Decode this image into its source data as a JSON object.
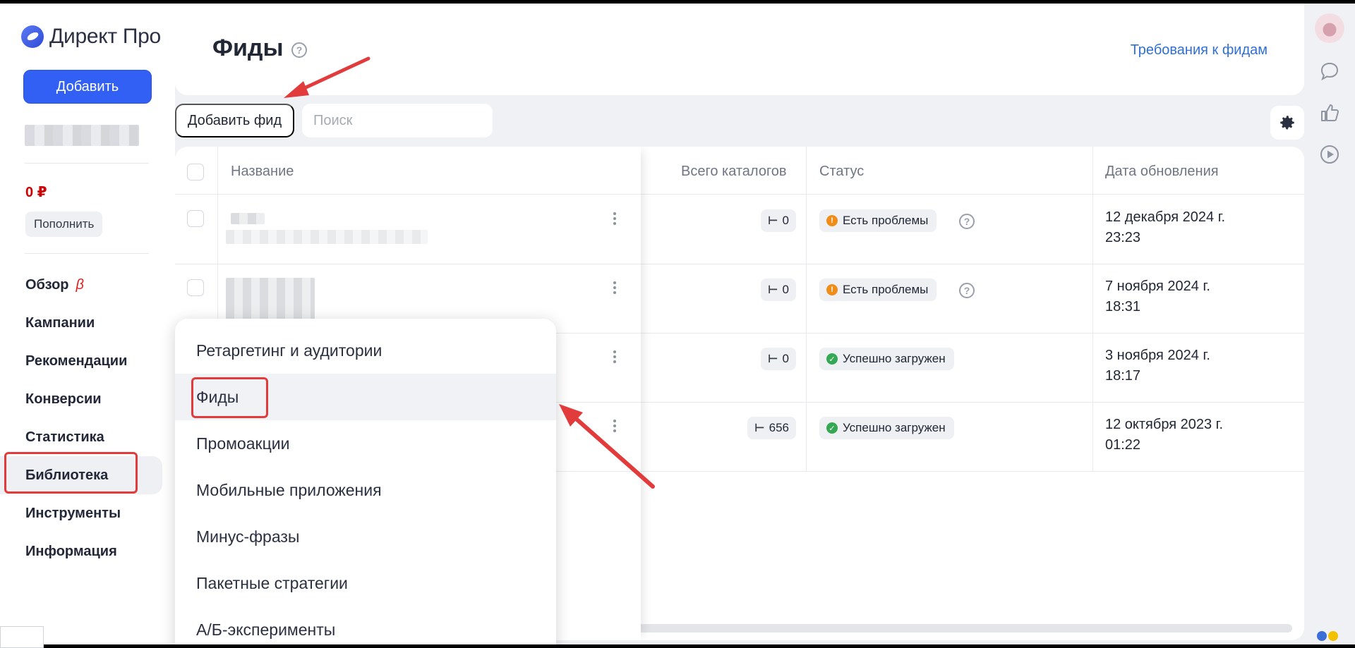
{
  "app": {
    "logo_text": "Директ Про",
    "add_button": "Добавить",
    "balance": "0 ₽",
    "topup_button": "Пополнить"
  },
  "nav": {
    "items": [
      {
        "label": "Обзор",
        "badge": "β"
      },
      {
        "label": "Кампании"
      },
      {
        "label": "Рекомендации"
      },
      {
        "label": "Конверсии"
      },
      {
        "label": "Статистика"
      },
      {
        "label": "Библиотека",
        "active": true
      },
      {
        "label": "Инструменты"
      },
      {
        "label": "Информация"
      }
    ]
  },
  "header": {
    "title": "Фиды",
    "help_glyph": "?",
    "requirements_link": "Требования к фидам"
  },
  "toolbar": {
    "add_feed_button": "Добавить фид",
    "search_placeholder": "Поиск"
  },
  "table": {
    "columns": [
      "Название",
      "Всего каталогов",
      "Статус",
      "Дата обновления"
    ],
    "rows": [
      {
        "catalogs": "0",
        "status": "Есть проблемы",
        "status_type": "warning",
        "date_line1": "12 декабря 2024 г.",
        "date_line2": "23:23"
      },
      {
        "catalogs": "0",
        "status": "Есть проблемы",
        "status_type": "warning",
        "date_line1": "7 ноября 2024 г.",
        "date_line2": "18:31"
      },
      {
        "catalogs": "0",
        "status": "Успешно загружен",
        "status_type": "success",
        "date_line1": "3 ноября 2024 г.",
        "date_line2": "18:17"
      },
      {
        "catalogs": "656",
        "status": "Успешно загружен",
        "status_type": "success",
        "date_line1": "12 октября 2023 г.",
        "date_line2": "01:22"
      }
    ]
  },
  "library_menu": {
    "items": [
      {
        "label": "Ретаргетинг и аудитории"
      },
      {
        "label": "Фиды",
        "highlighted": true
      },
      {
        "label": "Промоакции"
      },
      {
        "label": "Мобильные приложения"
      },
      {
        "label": "Минус-фразы"
      },
      {
        "label": "Пакетные стратегии"
      },
      {
        "label": "А/Б-эксперименты"
      }
    ]
  },
  "icons": {
    "settings": "gear-icon",
    "chat": "chat-icon",
    "like": "thumbs-up-icon",
    "play": "play-icon",
    "status_warning_glyph": "!",
    "status_success_glyph": "✓",
    "catalog_glyph": "⊢"
  },
  "colors": {
    "accent": "#3360f4",
    "link": "#2f6fd6",
    "annotation": "#e23b3b",
    "warning": "#f08c18",
    "success": "#35a853",
    "balance": "#cc0000"
  }
}
